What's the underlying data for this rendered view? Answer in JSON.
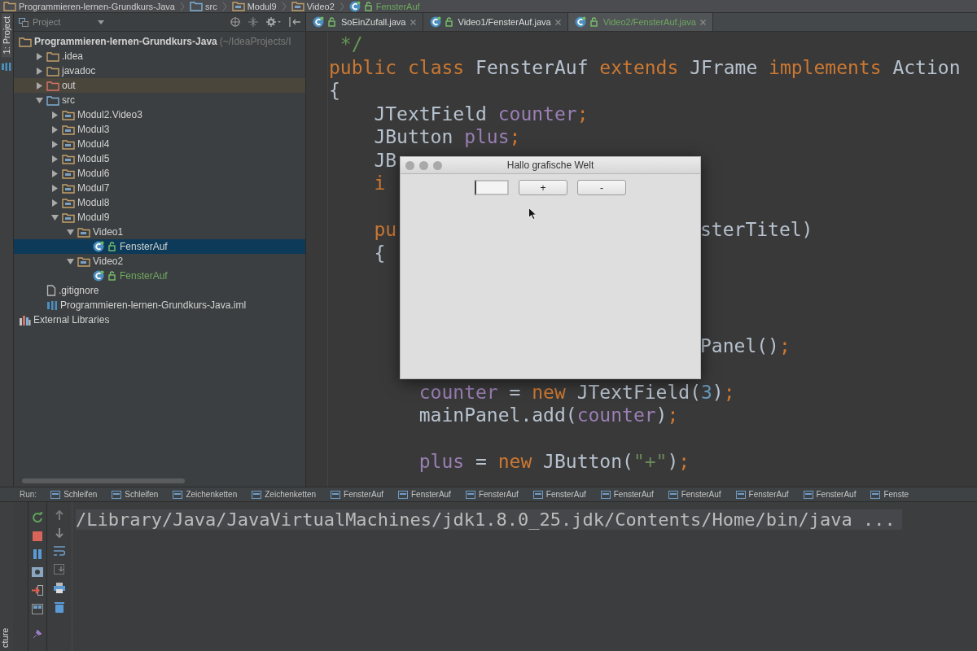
{
  "breadcrumbs": [
    {
      "label": "Programmieren-lernen-Grundkurs-Java",
      "kind": "project"
    },
    {
      "label": "src",
      "kind": "source"
    },
    {
      "label": "Modul9",
      "kind": "package"
    },
    {
      "label": "Video2",
      "kind": "package"
    },
    {
      "label": "FensterAuf",
      "kind": "class",
      "color": "#6fa85f"
    }
  ],
  "side_tabs": {
    "top": "1: Project",
    "bottom": "cture"
  },
  "project_panel": {
    "title": "Project",
    "tree": [
      {
        "label": "Programmieren-lernen-Grundkurs-Java",
        "hint": "(~/IdeaProjects/I",
        "kind": "project",
        "selected": false,
        "children": [
          {
            "label": ".idea",
            "kind": "folder",
            "expanded": false,
            "selected": false
          },
          {
            "label": "javadoc",
            "kind": "folder",
            "expanded": false,
            "selected": false
          },
          {
            "label": "out",
            "kind": "excluded",
            "expanded": false,
            "selected": false
          },
          {
            "label": "src",
            "kind": "source",
            "expanded": true,
            "selected": false,
            "children": [
              {
                "label": "Modul2.Video3",
                "kind": "package",
                "expanded": false,
                "selected": false
              },
              {
                "label": "Modul3",
                "kind": "package",
                "expanded": false,
                "selected": false
              },
              {
                "label": "Modul4",
                "kind": "package",
                "expanded": false,
                "selected": false
              },
              {
                "label": "Modul5",
                "kind": "package",
                "expanded": false,
                "selected": false
              },
              {
                "label": "Modul6",
                "kind": "package",
                "expanded": false,
                "selected": false
              },
              {
                "label": "Modul7",
                "kind": "package",
                "expanded": false,
                "selected": false
              },
              {
                "label": "Modul8",
                "kind": "package",
                "expanded": false,
                "selected": false
              },
              {
                "label": "Modul9",
                "kind": "package",
                "expanded": true,
                "selected": false,
                "children": [
                  {
                    "label": "Video1",
                    "kind": "package",
                    "expanded": true,
                    "selected": false,
                    "children": [
                      {
                        "label": "FensterAuf",
                        "kind": "class",
                        "selected": true
                      }
                    ]
                  },
                  {
                    "label": "Video2",
                    "kind": "package",
                    "expanded": true,
                    "selected": false,
                    "children": [
                      {
                        "label": "FensterAuf",
                        "kind": "class",
                        "color": "#6fa85f",
                        "selected": false
                      }
                    ]
                  }
                ]
              }
            ]
          },
          {
            "label": ".gitignore",
            "kind": "file",
            "selected": false
          },
          {
            "label": "Programmieren-lernen-Grundkurs-Java.iml",
            "kind": "module",
            "selected": false
          }
        ]
      },
      {
        "label": "External Libraries",
        "kind": "libraries",
        "selected": false
      }
    ]
  },
  "editor": {
    "tabs": [
      {
        "label": "SoEinZufall.java",
        "selected": false
      },
      {
        "label": "Video1/FensterAuf.java",
        "selected": false
      },
      {
        "label": "Video2/FensterAuf.java",
        "selected": true,
        "color": "#6fa85f"
      }
    ],
    "lines": [
      {
        "kind": "code",
        "tokens": [
          {
            "text": " */",
            "kind": "doc"
          }
        ]
      },
      {
        "kind": "code",
        "tokens": [
          {
            "text": "public",
            "kind": "kw"
          },
          {
            "text": " class",
            "kind": "kw"
          },
          {
            "text": " FensterAuf ",
            "kind": "plain"
          },
          {
            "text": "extends",
            "kind": "kw"
          },
          {
            "text": " JFrame ",
            "kind": "plain"
          },
          {
            "text": "implements",
            "kind": "kw"
          },
          {
            "text": " Action",
            "kind": "plain"
          }
        ]
      },
      {
        "kind": "code",
        "tokens": [
          {
            "text": "{",
            "kind": "plain"
          }
        ]
      },
      {
        "kind": "code",
        "tokens": [
          {
            "text": "    JTextField ",
            "kind": "plain"
          },
          {
            "text": "counter",
            "kind": "field"
          },
          {
            "text": ";",
            "kind": "kw"
          }
        ]
      },
      {
        "kind": "code",
        "tokens": [
          {
            "text": "    JButton ",
            "kind": "plain"
          },
          {
            "text": "plus",
            "kind": "field"
          },
          {
            "text": ";",
            "kind": "kw"
          }
        ]
      },
      {
        "kind": "code",
        "tokens": [
          {
            "text": "    JB",
            "kind": "plain"
          }
        ]
      },
      {
        "kind": "code",
        "tokens": [
          {
            "text": "    i",
            "kind": "kw"
          }
        ]
      },
      {
        "kind": "blank"
      },
      {
        "kind": "code",
        "tokens": [
          {
            "text": "    pu",
            "kind": "kw"
          }
        ],
        "right": [
          {
            "text": "sterTitel)",
            "kind": "plain"
          }
        ]
      },
      {
        "kind": "code",
        "tokens": [
          {
            "text": "    {",
            "kind": "plain"
          }
        ]
      },
      {
        "kind": "blank"
      },
      {
        "kind": "blank"
      },
      {
        "kind": "blank"
      },
      {
        "kind": "code",
        "right": [
          {
            "text": "Panel()",
            "kind": "plain"
          },
          {
            "text": ";",
            "kind": "kw"
          }
        ]
      },
      {
        "kind": "blank"
      },
      {
        "kind": "code",
        "tokens": [
          {
            "text": "        counter",
            "kind": "field"
          },
          {
            "text": " = ",
            "kind": "plain"
          },
          {
            "text": "new",
            "kind": "kw"
          },
          {
            "text": " JTextField(",
            "kind": "plain"
          },
          {
            "text": "3",
            "kind": "num"
          },
          {
            "text": ")",
            "kind": "plain"
          },
          {
            "text": ";",
            "kind": "kw"
          }
        ]
      },
      {
        "kind": "code",
        "tokens": [
          {
            "text": "        mainPanel.add(",
            "kind": "plain"
          },
          {
            "text": "counter",
            "kind": "field"
          },
          {
            "text": ")",
            "kind": "plain"
          },
          {
            "text": ";",
            "kind": "kw"
          }
        ]
      },
      {
        "kind": "blank"
      },
      {
        "kind": "code",
        "tokens": [
          {
            "text": "        plus",
            "kind": "field"
          },
          {
            "text": " = ",
            "kind": "plain"
          },
          {
            "text": "new",
            "kind": "kw"
          },
          {
            "text": " JButton(",
            "kind": "plain"
          },
          {
            "text": "\"+\"",
            "kind": "str"
          },
          {
            "text": ")",
            "kind": "plain"
          },
          {
            "text": ";",
            "kind": "kw"
          }
        ]
      }
    ]
  },
  "dialog": {
    "title": "Hallo grafische Welt",
    "buttons": [
      "+",
      "-"
    ]
  },
  "run": {
    "label": "Run:",
    "tabs": [
      "Schleifen",
      "Schleifen",
      "Zeichenketten",
      "Zeichenketten",
      "FensterAuf",
      "FensterAuf",
      "FensterAuf",
      "FensterAuf",
      "FensterAuf",
      "FensterAuf",
      "FensterAuf",
      "FensterAuf",
      "Fenste"
    ],
    "console": [
      "/Library/Java/JavaVirtualMachines/jdk1.8.0_25.jdk/Contents/Home/bin/java ..."
    ]
  }
}
